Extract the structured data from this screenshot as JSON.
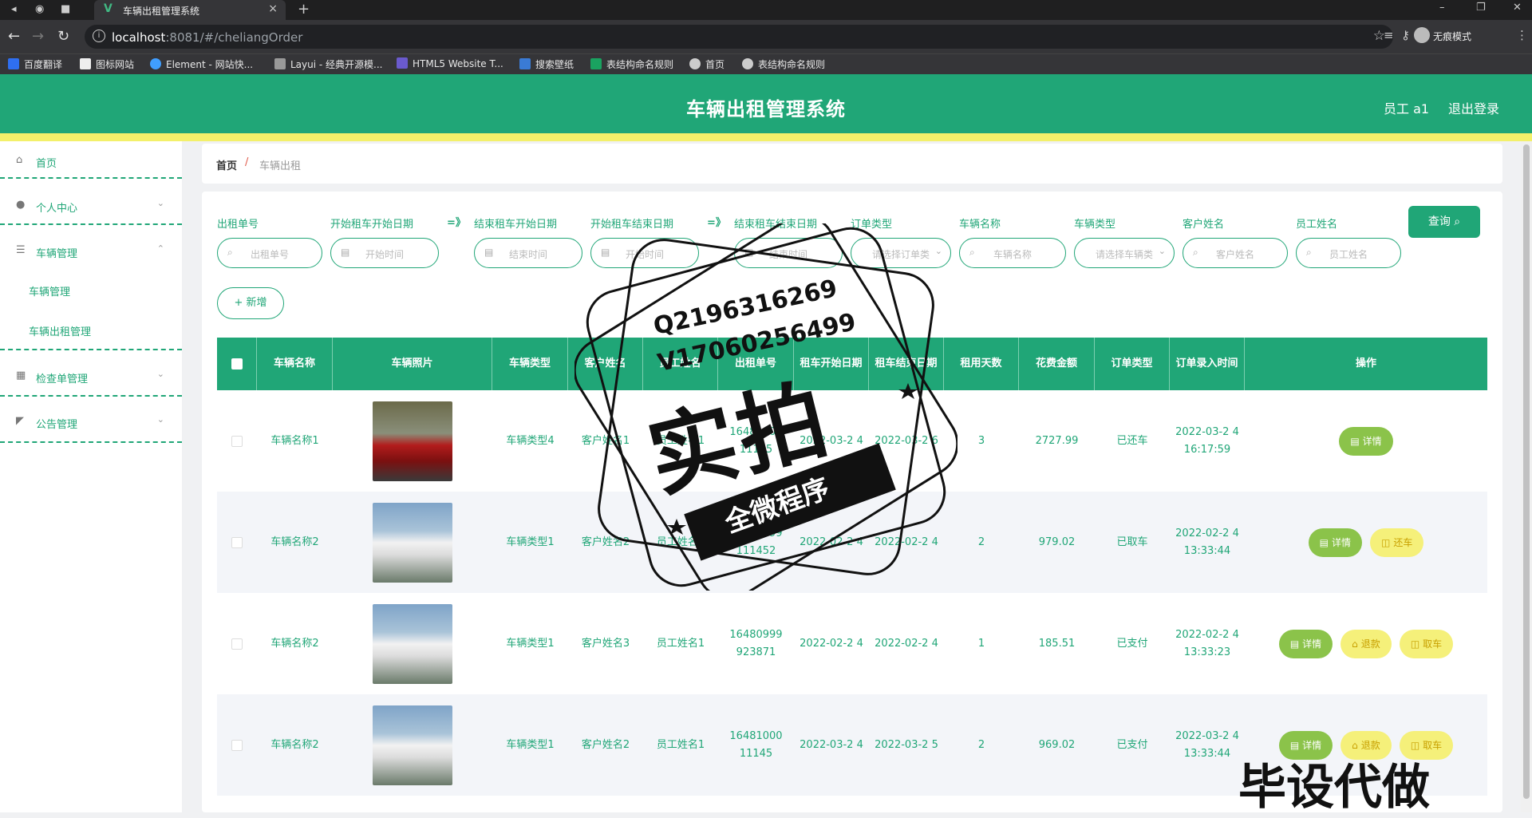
{
  "browser": {
    "tab_title": "车辆出租管理系统",
    "tab_close": "×",
    "tab_new": "+",
    "url_host": "localhost",
    "url_rest": ":8081/#/cheliangOrder",
    "incognito": "无痕模式",
    "bookmarks": [
      "百度翻译",
      "图标网站",
      "Element - 网站快...",
      "Layui - 经典开源模...",
      "HTML5 Website T...",
      "搜索壁纸",
      "表结构命名规则",
      "首页",
      "表结构命名规则"
    ]
  },
  "header": {
    "title": "车辆出租管理系统",
    "user": "员工 a1",
    "logout": "退出登录"
  },
  "sidebar": {
    "home": "首页",
    "personal": "个人中心",
    "vehicle_mgmt": "车辆管理",
    "sub_vehicle": "车辆管理",
    "sub_rental": "车辆出租管理",
    "inspection": "检查单管理",
    "notice": "公告管理"
  },
  "breadcrumb": {
    "home": "首页",
    "sep": "/",
    "current": "车辆出租"
  },
  "filters": {
    "order_no": {
      "label": "出租单号",
      "placeholder": "出租单号"
    },
    "start_from": {
      "label": "开始租车开始日期",
      "placeholder": "开始时间"
    },
    "arrow1": "=》",
    "end_from": {
      "label": "结束租车开始日期",
      "placeholder": "结束时间"
    },
    "start_to": {
      "label": "开始租车结束日期",
      "placeholder": "开始时间"
    },
    "arrow2": "=》",
    "end_to": {
      "label": "结束租车结束日期",
      "placeholder": "结束时间"
    },
    "order_type": {
      "label": "订单类型",
      "placeholder": "请选择订单类"
    },
    "vehicle_name": {
      "label": "车辆名称",
      "placeholder": "车辆名称"
    },
    "vehicle_type": {
      "label": "车辆类型",
      "placeholder": "请选择车辆类"
    },
    "customer": {
      "label": "客户姓名",
      "placeholder": "客户姓名"
    },
    "staff": {
      "label": "员工姓名",
      "placeholder": "员工姓名"
    },
    "query": "查询",
    "add": "+ 新增"
  },
  "table": {
    "headers": [
      "车辆名称",
      "车辆照片",
      "车辆类型",
      "客户姓名",
      "员工姓名",
      "出租单号",
      "租车开始日期",
      "租车结束日期",
      "租用天数",
      "花费金额",
      "订单类型",
      "订单录入时间",
      "操作"
    ],
    "rows": [
      {
        "name": "车辆名称1",
        "photo": "car-red",
        "type": "车辆类型4",
        "customer": "客户姓名1",
        "staff": "员工姓名1",
        "order_no": "16481000 11145",
        "start": "2022-03-2 4",
        "end": "2022-03-2 6",
        "days": "3",
        "amount": "2727.99",
        "status": "已还车",
        "created": "2022-03-2 4 16:17:59",
        "ops": [
          "详情"
        ]
      },
      {
        "name": "车辆名称2",
        "photo": "car-white",
        "type": "车辆类型1",
        "customer": "客户姓名2",
        "staff": "员工姓名1",
        "order_no": "16480999 111452",
        "start": "2022-02-2 4",
        "end": "2022-02-2 4",
        "days": "2",
        "amount": "979.02",
        "status": "已取车",
        "created": "2022-02-2 4 13:33:44",
        "ops": [
          "详情",
          "还车"
        ]
      },
      {
        "name": "车辆名称2",
        "photo": "car-white",
        "type": "车辆类型1",
        "customer": "客户姓名3",
        "staff": "员工姓名1",
        "order_no": "16480999 923871",
        "start": "2022-02-2 4",
        "end": "2022-02-2 4",
        "days": "1",
        "amount": "185.51",
        "status": "已支付",
        "created": "2022-02-2 4 13:33:23",
        "ops": [
          "详情",
          "退款",
          "取车"
        ]
      },
      {
        "name": "车辆名称2",
        "photo": "car-white",
        "type": "车辆类型1",
        "customer": "客户姓名2",
        "staff": "员工姓名1",
        "order_no": "16481000 11145",
        "start": "2022-03-2 4",
        "end": "2022-03-2 5",
        "days": "2",
        "amount": "969.02",
        "status": "已支付",
        "created": "2022-03-2 4 13:33:44",
        "ops": [
          "详情",
          "退款",
          "取车"
        ]
      }
    ]
  },
  "watermark": {
    "line1": "Q2196316269",
    "line2": "V17060256499",
    "big": "实拍",
    "banner": "全微程序",
    "corner": "毕设代做"
  },
  "colors": {
    "primary": "#20a677",
    "accent_yellow": "#f3f06a",
    "detail_btn": "#8bc34a"
  }
}
